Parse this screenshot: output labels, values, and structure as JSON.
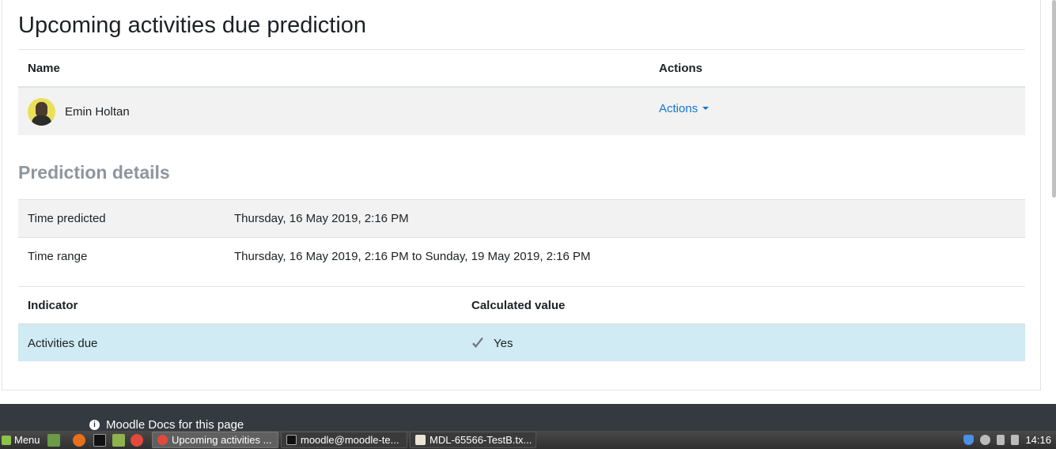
{
  "page": {
    "title": "Upcoming activities due prediction"
  },
  "users_table": {
    "headers": {
      "name": "Name",
      "actions": "Actions"
    },
    "rows": [
      {
        "name": "Emin Holtan",
        "actions_label": "Actions"
      }
    ]
  },
  "prediction_details": {
    "heading": "Prediction details",
    "rows": [
      {
        "label": "Time predicted",
        "value": "Thursday, 16 May 2019, 2:16 PM"
      },
      {
        "label": "Time range",
        "value": "Thursday, 16 May 2019, 2:16 PM to Sunday, 19 May 2019, 2:16 PM"
      }
    ]
  },
  "indicators_table": {
    "headers": {
      "indicator": "Indicator",
      "calculated_value": "Calculated value"
    },
    "rows": [
      {
        "indicator": "Activities due",
        "value": "Yes",
        "icon": "check-icon"
      }
    ]
  },
  "footer": {
    "docs_link": "Moodle Docs for this page"
  },
  "taskbar": {
    "menu_label": "Menu",
    "windows": [
      {
        "label": "Upcoming activities ...",
        "active": true
      },
      {
        "label": "moodle@moodle-te...",
        "active": false
      },
      {
        "label": "MDL-65566-TestB.tx...",
        "active": false
      }
    ],
    "clock": "14:16"
  },
  "colors": {
    "link": "#1177d1",
    "highlight_row": "#d0ebf3",
    "striped_row": "#f2f2f2",
    "muted_heading": "#8f959e",
    "footer_bg": "#343a40"
  }
}
